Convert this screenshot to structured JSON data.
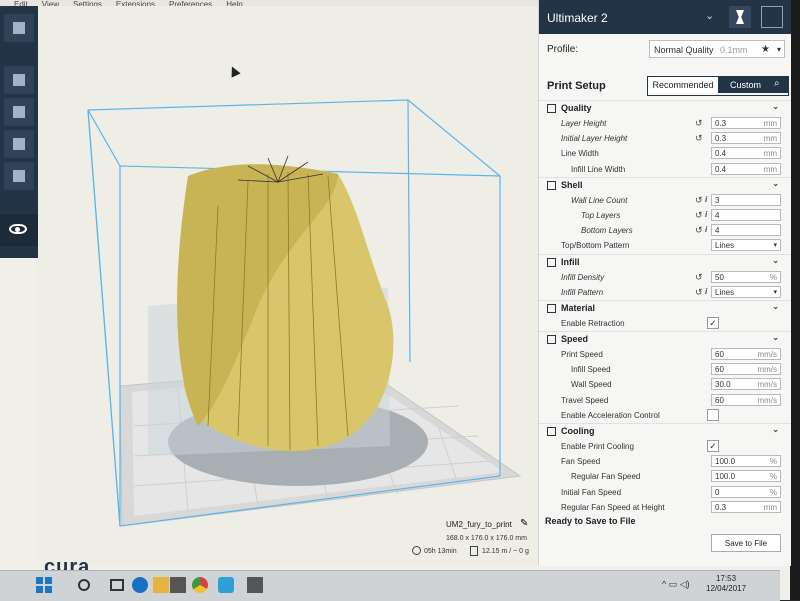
{
  "menubar": {
    "items": [
      "Edit",
      "View",
      "Settings",
      "Extensions",
      "Preferences",
      "Help"
    ]
  },
  "printer": {
    "name": "Ultimaker 2"
  },
  "profile": {
    "label": "Profile:",
    "value": "Normal Quality",
    "value_sub": "0.1mm"
  },
  "setup": {
    "title": "Print Setup",
    "tab_recommended": "Recommended",
    "tab_custom": "Custom"
  },
  "categories": [
    {
      "name": "Quality",
      "icon": "quality-icon",
      "rows": [
        {
          "label": "Layer Height",
          "italic": true,
          "indent": 22,
          "reset": true,
          "value": "0.3",
          "unit": "mm"
        },
        {
          "label": "Initial Layer Height",
          "italic": true,
          "indent": 22,
          "reset": true,
          "value": "0.3",
          "unit": "mm"
        },
        {
          "label": "Line Width",
          "italic": false,
          "indent": 22,
          "value": "0.4",
          "unit": "mm"
        },
        {
          "label": "Infill Line Width",
          "italic": false,
          "indent": 32,
          "value": "0.4",
          "unit": "mm"
        }
      ]
    },
    {
      "name": "Shell",
      "icon": "shell-icon",
      "rows": [
        {
          "label": "Wall Line Count",
          "italic": true,
          "indent": 32,
          "reset": true,
          "info": true,
          "value": "3",
          "unit": ""
        },
        {
          "label": "Top Layers",
          "italic": true,
          "indent": 42,
          "reset": true,
          "info": true,
          "value": "4",
          "unit": ""
        },
        {
          "label": "Bottom Layers",
          "italic": true,
          "indent": 42,
          "reset": true,
          "info": true,
          "value": "4",
          "unit": ""
        },
        {
          "label": "Top/Bottom Pattern",
          "italic": false,
          "indent": 22,
          "select": "Lines"
        }
      ]
    },
    {
      "name": "Infill",
      "icon": "infill-icon",
      "rows": [
        {
          "label": "Infill Density",
          "italic": true,
          "indent": 22,
          "reset": true,
          "value": "50",
          "unit": "%"
        },
        {
          "label": "Infill Pattern",
          "italic": true,
          "indent": 22,
          "reset": true,
          "info": true,
          "select": "Lines"
        }
      ]
    },
    {
      "name": "Material",
      "icon": "material-icon",
      "rows": [
        {
          "label": "Enable Retraction",
          "italic": false,
          "indent": 22,
          "checkbox": true,
          "checked": true
        }
      ]
    },
    {
      "name": "Speed",
      "icon": "speed-icon",
      "rows": [
        {
          "label": "Print Speed",
          "italic": false,
          "indent": 22,
          "value": "60",
          "unit": "mm/s"
        },
        {
          "label": "Infill Speed",
          "italic": false,
          "indent": 32,
          "value": "60",
          "unit": "mm/s"
        },
        {
          "label": "Wall Speed",
          "italic": false,
          "indent": 32,
          "value": "30.0",
          "unit": "mm/s"
        },
        {
          "label": "Travel Speed",
          "italic": false,
          "indent": 22,
          "value": "60",
          "unit": "mm/s"
        },
        {
          "label": "Enable Acceleration Control",
          "italic": false,
          "indent": 22,
          "checkbox": true,
          "checked": false
        }
      ]
    },
    {
      "name": "Cooling",
      "icon": "cooling-icon",
      "rows": [
        {
          "label": "Enable Print Cooling",
          "italic": false,
          "indent": 22,
          "checkbox": true,
          "checked": true
        },
        {
          "label": "Fan Speed",
          "italic": false,
          "indent": 22,
          "value": "100.0",
          "unit": "%"
        },
        {
          "label": "Regular Fan Speed",
          "italic": false,
          "indent": 32,
          "value": "100.0",
          "unit": "%"
        },
        {
          "label": "Initial Fan Speed",
          "italic": false,
          "indent": 22,
          "value": "0",
          "unit": "%"
        },
        {
          "label": "Regular Fan Speed at Height",
          "italic": false,
          "indent": 22,
          "value": "0.3",
          "unit": "mm"
        }
      ]
    }
  ],
  "ready": "Ready to Save to File",
  "save_button": "Save to File",
  "job": {
    "name": "UM2_fury_to_print",
    "dims": "168.0 x 176.0 x 176.0 mm",
    "time": "05h 13min",
    "material": "12.15 m / ~ 0 g"
  },
  "logo": {
    "text": "cura",
    "dot": "."
  },
  "taskbar": {
    "time": "17:53",
    "date": "12/04/2017",
    "tray": "^ ▭ ◁)"
  },
  "colors": {
    "model": "#d9c66a",
    "build_volume": "#5fb4e6",
    "header": "#243447"
  }
}
